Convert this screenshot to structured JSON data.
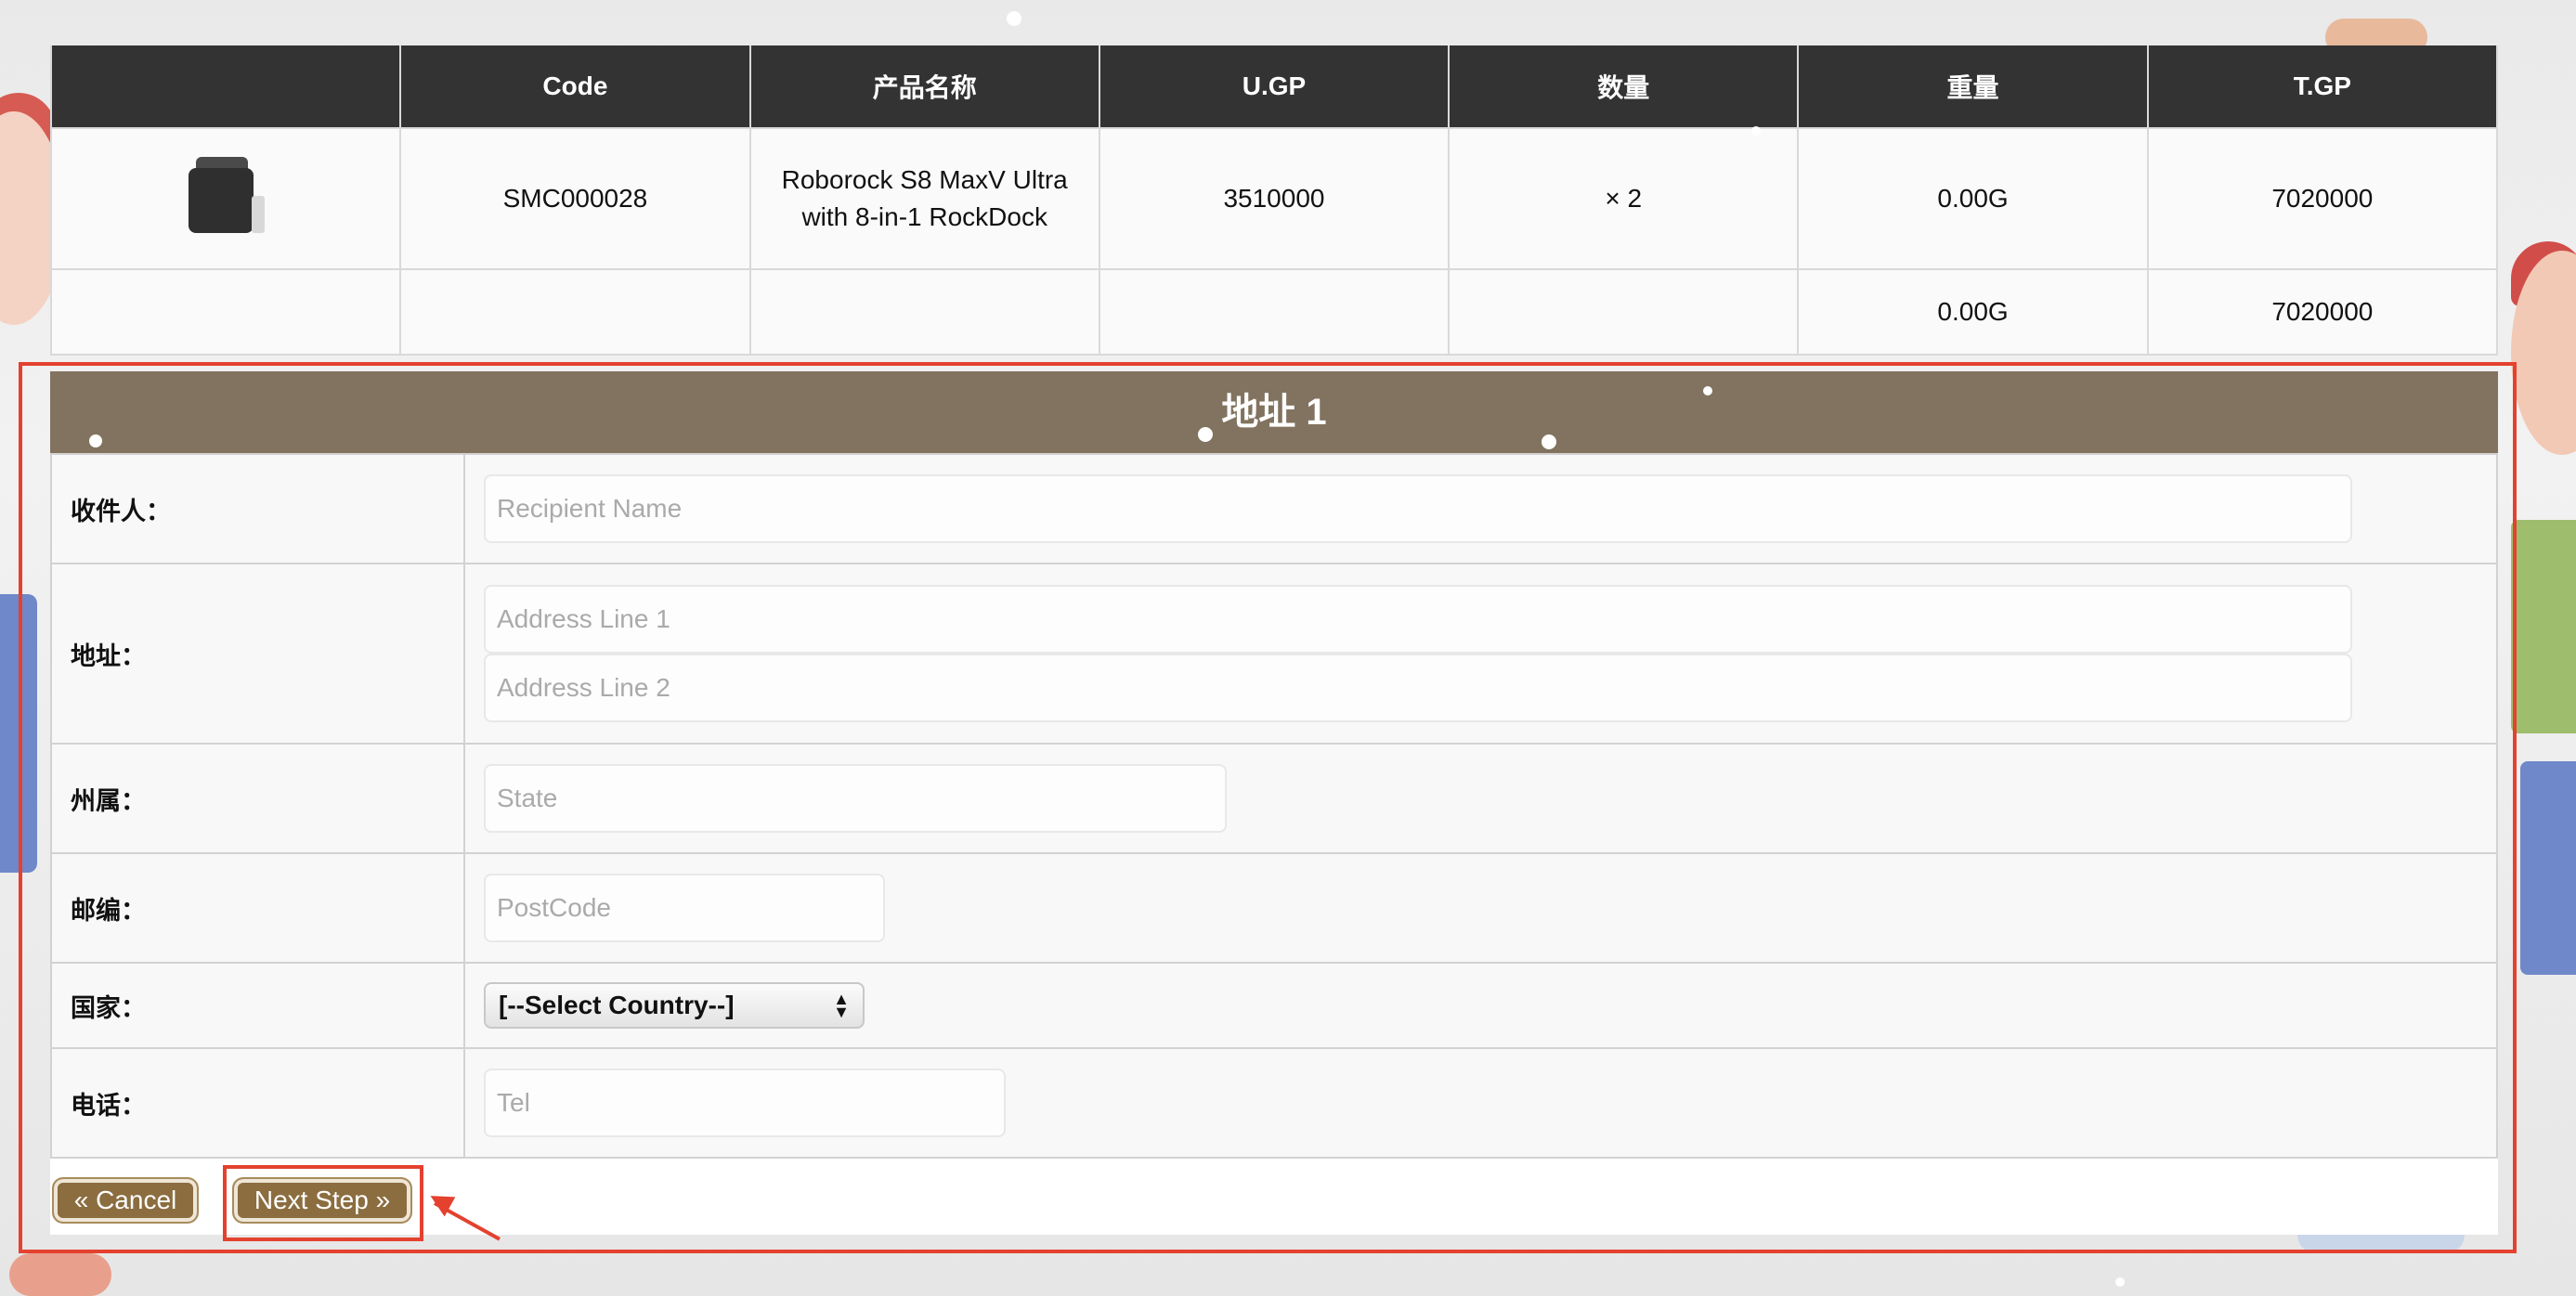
{
  "cart_table": {
    "headers": [
      "",
      "Code",
      "产品名称",
      "U.GP",
      "数量",
      "重量",
      "T.GP"
    ],
    "item": {
      "code": "SMC000028",
      "name": "Roborock S8 MaxV Ultra with 8-in-1 RockDock",
      "unit_gp": "3510000",
      "quantity": "× 2",
      "weight": "0.00G",
      "total_gp": "7020000"
    },
    "totals": {
      "weight": "0.00G",
      "total_gp": "7020000"
    }
  },
  "address_form": {
    "title": "地址 1",
    "recipient": {
      "label": "收件人：",
      "placeholder": "Recipient Name"
    },
    "address": {
      "label": "地址：",
      "line1_placeholder": "Address Line 1",
      "line2_placeholder": "Address Line 2"
    },
    "state": {
      "label": "州属：",
      "placeholder": "State"
    },
    "postcode": {
      "label": "邮编：",
      "placeholder": "PostCode"
    },
    "country": {
      "label": "国家：",
      "selected": "[--Select Country--]"
    },
    "tel": {
      "label": "电话：",
      "placeholder": "Tel"
    }
  },
  "buttons": {
    "cancel": "« Cancel",
    "next": "Next Step »"
  },
  "colors": {
    "header_bg": "#333333",
    "form_title_bg": "#81735f",
    "button_bg": "#8b6d3f",
    "highlight": "#e4412f"
  }
}
